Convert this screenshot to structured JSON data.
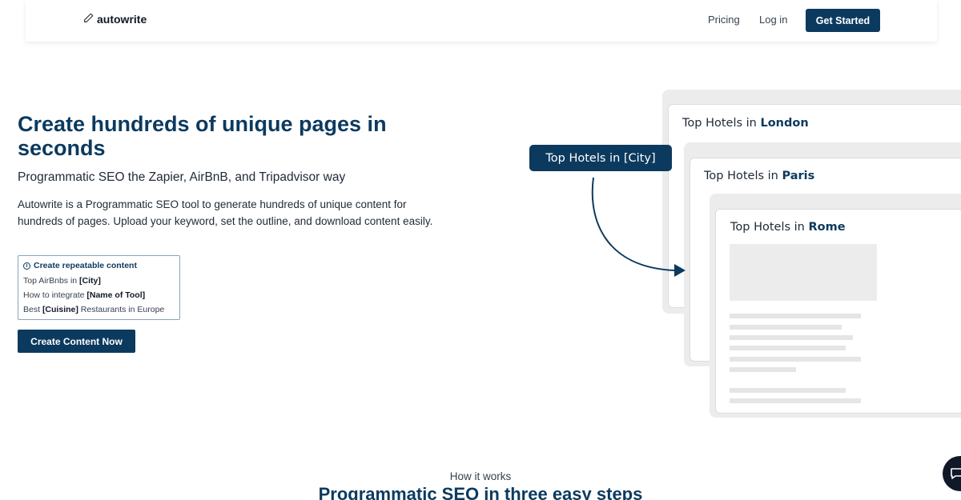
{
  "nav": {
    "brand": "autowrite",
    "links": [
      "Pricing",
      "Log in"
    ],
    "cta": "Get Started"
  },
  "hero": {
    "title": "Create hundreds of unique pages in seconds",
    "subtitle": "Programmatic SEO the Zapier, AirBnB, and Tripadvisor way",
    "description": "Autowrite is a Programmatic SEO tool to generate hundreds of unique content for hundreds of pages. Upload your keyword, set the outline, and download content easily.",
    "examples": {
      "header": "Create repeatable content",
      "items": [
        {
          "before": "Top AirBnbs in ",
          "token": "[City]",
          "after": ""
        },
        {
          "before": "How to integrate ",
          "token": "[Name of Tool]",
          "after": ""
        },
        {
          "before": "Best ",
          "token": "[Cuisine]",
          "after": " Restaurants in Europe"
        }
      ]
    },
    "cta": "Create Content Now"
  },
  "illustration": {
    "template_pill": "Top Hotels in [City]",
    "cards": [
      {
        "prefix": "Top Hotels in ",
        "city": "London"
      },
      {
        "prefix": "Top Hotels in ",
        "city": "Paris"
      },
      {
        "prefix": "Top Hotels in ",
        "city": "Rome"
      }
    ]
  },
  "section2": {
    "label": "How it works",
    "title": "Programmatic SEO in three easy steps"
  },
  "colors": {
    "primary": "#0c3a5f",
    "card_shell": "#ececec",
    "placeholder": "#e5e5e5"
  },
  "icons": [
    "pencil-icon",
    "info-icon",
    "arrow-icon",
    "chat-icon"
  ]
}
